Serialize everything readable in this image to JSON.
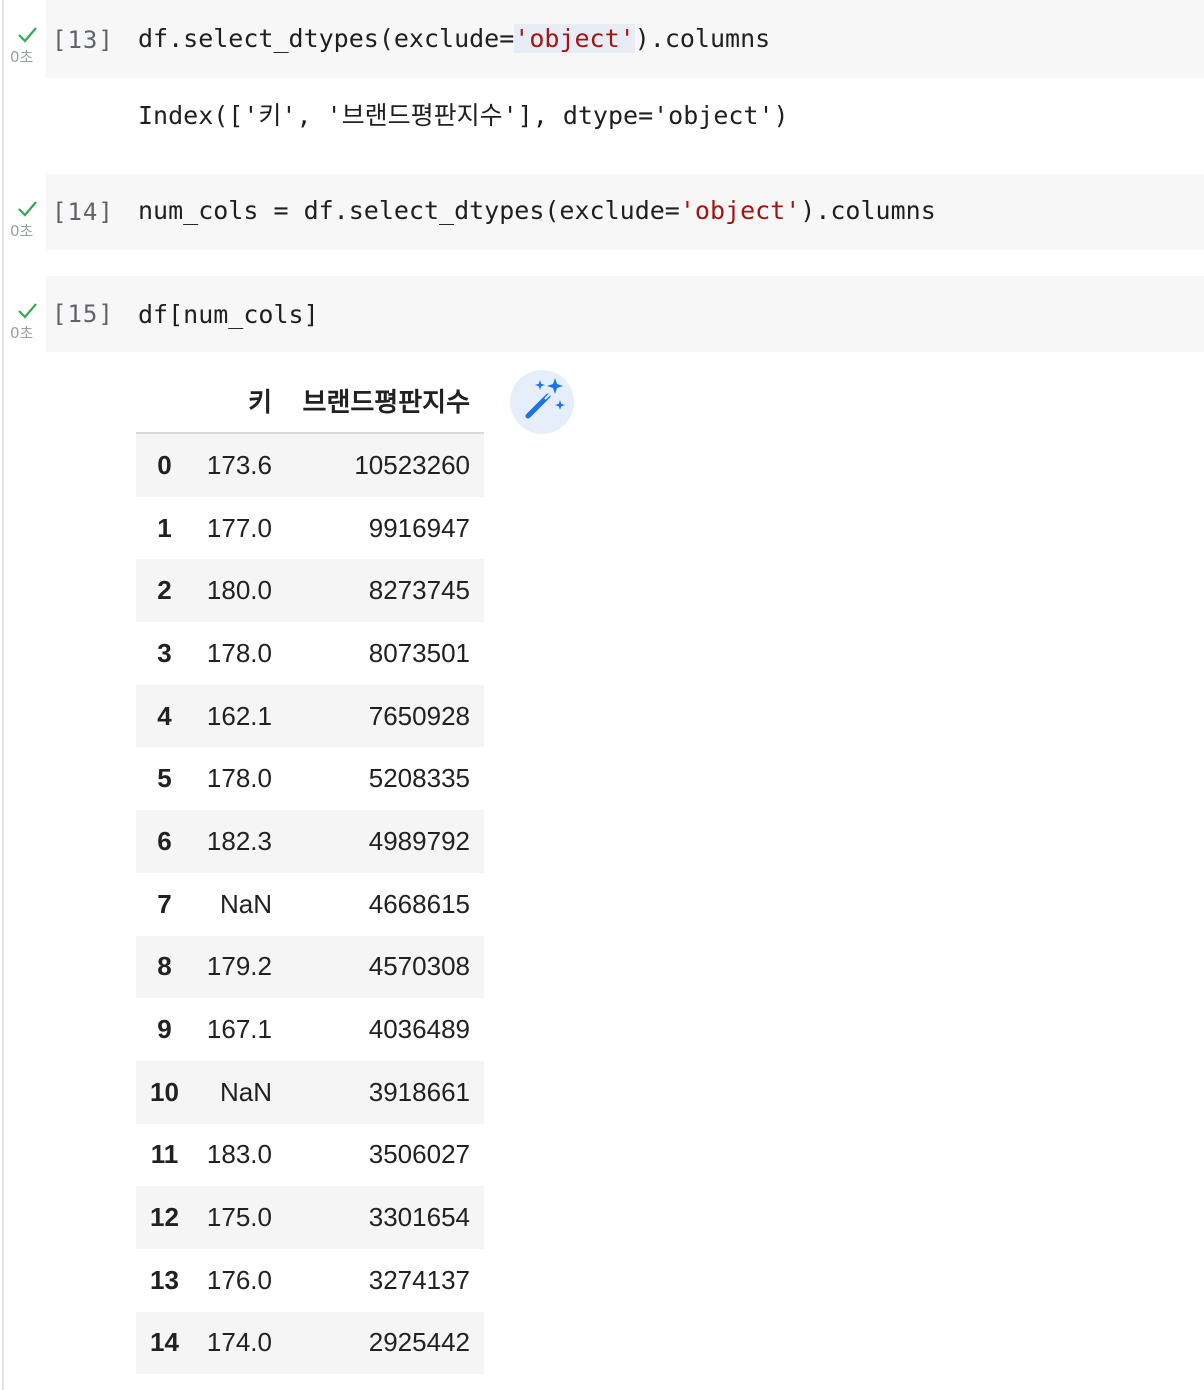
{
  "cells": [
    {
      "prompt": "[13]",
      "exec_time": "0초",
      "code_pre": "df.select_dtypes(exclude=",
      "code_str": "'object'",
      "code_post": ").columns",
      "output": "Index(['키', '브랜드평판지수'], dtype='object')"
    },
    {
      "prompt": "[14]",
      "exec_time": "0초",
      "code_pre": "num_cols = df.select_dtypes(exclude=",
      "code_str": "'object'",
      "code_post": ").columns"
    },
    {
      "prompt": "[15]",
      "exec_time": "0초",
      "code": "df[num_cols]"
    }
  ],
  "dataframe": {
    "columns": [
      "",
      "키",
      "브랜드평판지수"
    ],
    "rows": [
      [
        "0",
        "173.6",
        "10523260"
      ],
      [
        "1",
        "177.0",
        "9916947"
      ],
      [
        "2",
        "180.0",
        "8273745"
      ],
      [
        "3",
        "178.0",
        "8073501"
      ],
      [
        "4",
        "162.1",
        "7650928"
      ],
      [
        "5",
        "178.0",
        "5208335"
      ],
      [
        "6",
        "182.3",
        "4989792"
      ],
      [
        "7",
        "NaN",
        "4668615"
      ],
      [
        "8",
        "179.2",
        "4570308"
      ],
      [
        "9",
        "167.1",
        "4036489"
      ],
      [
        "10",
        "NaN",
        "3918661"
      ],
      [
        "11",
        "183.0",
        "3506027"
      ],
      [
        "12",
        "175.0",
        "3301654"
      ],
      [
        "13",
        "176.0",
        "3274137"
      ],
      [
        "14",
        "174.0",
        "2925442"
      ]
    ]
  },
  "colors": {
    "check": "#34a853",
    "string": "#a31515",
    "magic_icon": "#1a73e8",
    "magic_bg": "#e6eefc"
  },
  "icons": {
    "check": "check-icon",
    "magic": "magic-wand-sparkles-icon"
  }
}
